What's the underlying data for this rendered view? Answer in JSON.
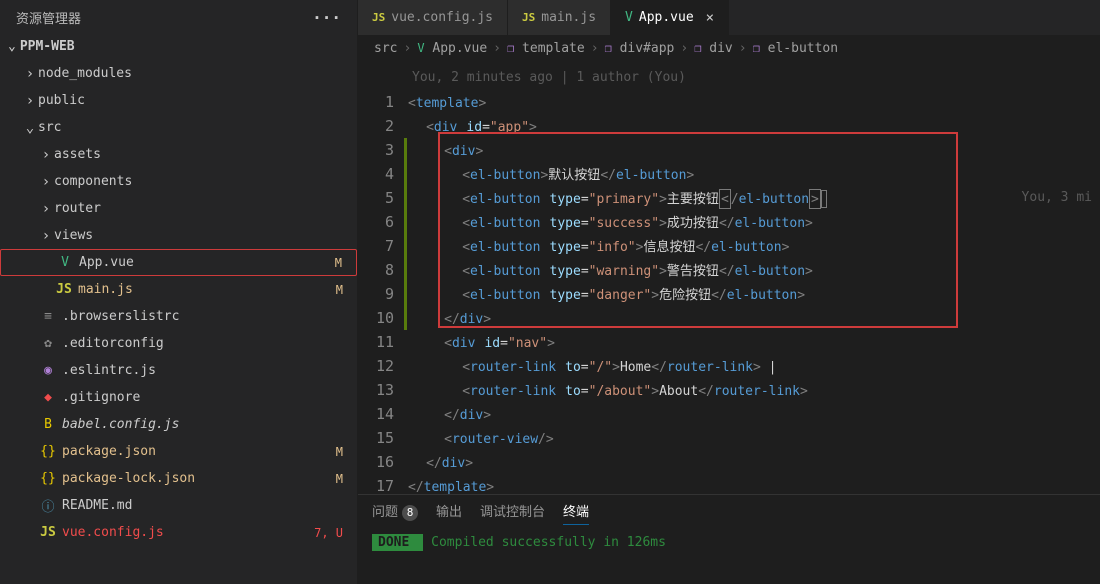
{
  "sidebar": {
    "title": "资源管理器",
    "root": "PPM-WEB",
    "items": [
      {
        "type": "folder",
        "label": "node_modules",
        "indent": 22,
        "chev": "›"
      },
      {
        "type": "folder",
        "label": "public",
        "indent": 22,
        "chev": "›"
      },
      {
        "type": "folder",
        "label": "src",
        "indent": 22,
        "chev": "⌄",
        "dot": true
      },
      {
        "type": "folder",
        "label": "assets",
        "indent": 38,
        "chev": "›"
      },
      {
        "type": "folder",
        "label": "components",
        "indent": 38,
        "chev": "›"
      },
      {
        "type": "folder",
        "label": "router",
        "indent": 38,
        "chev": "›"
      },
      {
        "type": "folder",
        "label": "views",
        "indent": 38,
        "chev": "›"
      },
      {
        "type": "file",
        "label": "App.vue",
        "indent": 38,
        "icon": "V",
        "iconClass": "vue-icon",
        "status": "M",
        "statusClass": "orange",
        "selected": true,
        "boxed": true
      },
      {
        "type": "file",
        "label": "main.js",
        "indent": 38,
        "icon": "JS",
        "iconClass": "js-icon",
        "status": "M",
        "statusClass": "orange",
        "labelClass": "orange"
      },
      {
        "type": "file",
        "label": ".browserslistrc",
        "indent": 22,
        "icon": "≡",
        "iconClass": "gray"
      },
      {
        "type": "file",
        "label": ".editorconfig",
        "indent": 22,
        "icon": "✿",
        "iconClass": "gray"
      },
      {
        "type": "file",
        "label": ".eslintrc.js",
        "indent": 22,
        "icon": "◉",
        "iconClass": "purple"
      },
      {
        "type": "file",
        "label": ".gitignore",
        "indent": 22,
        "icon": "◆",
        "iconClass": "red"
      },
      {
        "type": "file",
        "label": "babel.config.js",
        "indent": 22,
        "icon": "B",
        "iconClass": "yellow",
        "italic": true
      },
      {
        "type": "file",
        "label": "package.json",
        "indent": 22,
        "icon": "{}",
        "iconClass": "yellow",
        "status": "M",
        "statusClass": "orange",
        "labelClass": "orange"
      },
      {
        "type": "file",
        "label": "package-lock.json",
        "indent": 22,
        "icon": "{}",
        "iconClass": "yellow",
        "status": "M",
        "statusClass": "orange",
        "labelClass": "orange"
      },
      {
        "type": "file",
        "label": "README.md",
        "indent": 22,
        "icon": "ⓘ",
        "iconClass": "blue"
      },
      {
        "type": "file",
        "label": "vue.config.js",
        "indent": 22,
        "icon": "JS",
        "iconClass": "js-icon",
        "status": "7, U",
        "statusClass": "red",
        "labelClass": "red"
      }
    ]
  },
  "tabs": [
    {
      "label": "vue.config.js",
      "icon": "JS",
      "iconClass": "js-icon",
      "active": false
    },
    {
      "label": "main.js",
      "icon": "JS",
      "iconClass": "js-icon",
      "active": false
    },
    {
      "label": "App.vue",
      "icon": "V",
      "iconClass": "vue-icon",
      "active": true,
      "close": true
    }
  ],
  "breadcrumbs": {
    "parts": [
      {
        "text": "src",
        "icon": ""
      },
      {
        "text": "App.vue",
        "icon": "V",
        "iconClass": "vue-icon"
      },
      {
        "text": "template",
        "icon": "❐",
        "iconClass": "cube"
      },
      {
        "text": "div#app",
        "icon": "❐",
        "iconClass": "cube"
      },
      {
        "text": "div",
        "icon": "❐",
        "iconClass": "cube"
      },
      {
        "text": "el-button",
        "icon": "❐",
        "iconClass": "cube"
      }
    ]
  },
  "blame": "You, 2 minutes ago | 1 author (You)",
  "lineBlame": "You, 3 mi",
  "panel": {
    "tabs": [
      {
        "label": "问题",
        "badge": "8"
      },
      {
        "label": "输出"
      },
      {
        "label": "调试控制台"
      },
      {
        "label": "终端",
        "active": true
      }
    ],
    "doneLabel": " DONE ",
    "terminal": "Compiled successfully in 126ms"
  },
  "code": {
    "buttons": {
      "default": "默认按钮",
      "primary": "主要按钮",
      "success": "成功按钮",
      "info": "信息按钮",
      "warning": "警告按钮",
      "danger": "危险按钮"
    },
    "nav": {
      "home": "Home",
      "about": "About"
    }
  }
}
